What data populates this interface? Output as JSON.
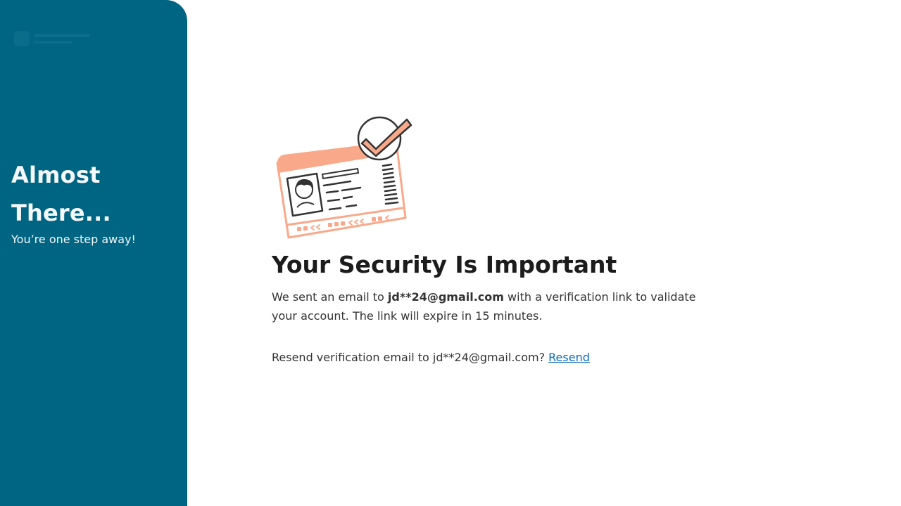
{
  "sidebar": {
    "headline": "Almost There...",
    "subtitle": "You’re one step away!",
    "background_color": "#006582"
  },
  "illustration": {
    "icon": "id-card-verified-icon",
    "accent_color": "#f9a98a"
  },
  "main": {
    "title": "Your Security Is Important",
    "message_prefix": "We sent an email to ",
    "email_masked": "jd**24@gmail.com",
    "message_suffix": " with a verification link to validate your account. The link will expire in 15 minutes.",
    "resend_prompt": "Resend verification email to jd**24@gmail.com?",
    "resend_link_label": "Resend",
    "link_color": "#0a6bbd"
  }
}
